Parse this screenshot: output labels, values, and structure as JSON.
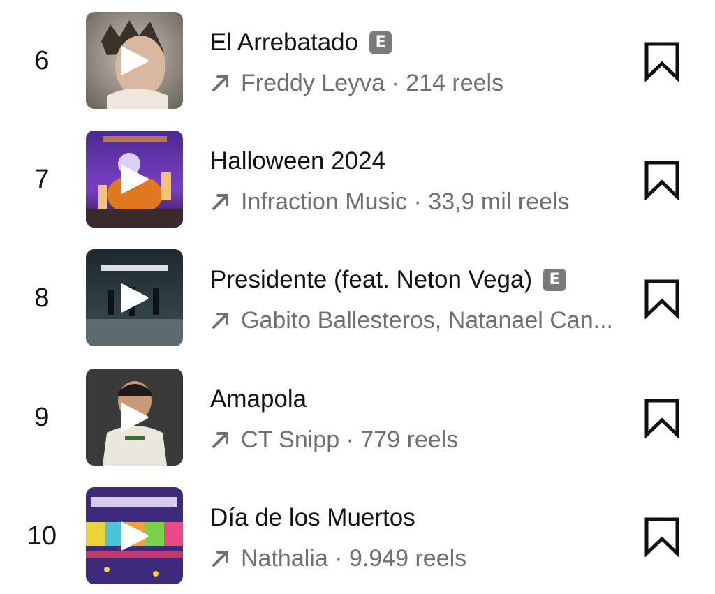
{
  "items": [
    {
      "rank": "6",
      "title": "El Arrebatado",
      "explicit": "E",
      "subtitle": "Freddy Leyva · 214 reels",
      "show_explicit": true
    },
    {
      "rank": "7",
      "title": "Halloween 2024",
      "explicit": "",
      "subtitle": "Infraction Music · 33,9 mil reels",
      "show_explicit": false
    },
    {
      "rank": "8",
      "title": "Presidente (feat. Neton Vega)",
      "explicit": "E",
      "subtitle": "Gabito Ballesteros, Natanael Can...",
      "show_explicit": true
    },
    {
      "rank": "9",
      "title": "Amapola",
      "explicit": "",
      "subtitle": "CT Snipp · 779 reels",
      "show_explicit": false
    },
    {
      "rank": "10",
      "title": "Día de los Muertos",
      "explicit": "",
      "subtitle": "Nathalia · 9.949 reels",
      "show_explicit": false
    }
  ],
  "icons": {
    "trend": "trending-up-arrow-icon",
    "save": "bookmark-icon",
    "play": "play-icon"
  },
  "colors": {
    "title": "#111111",
    "subtitle": "#6f6f6f",
    "explicit_badge": "#7a7a7a"
  }
}
